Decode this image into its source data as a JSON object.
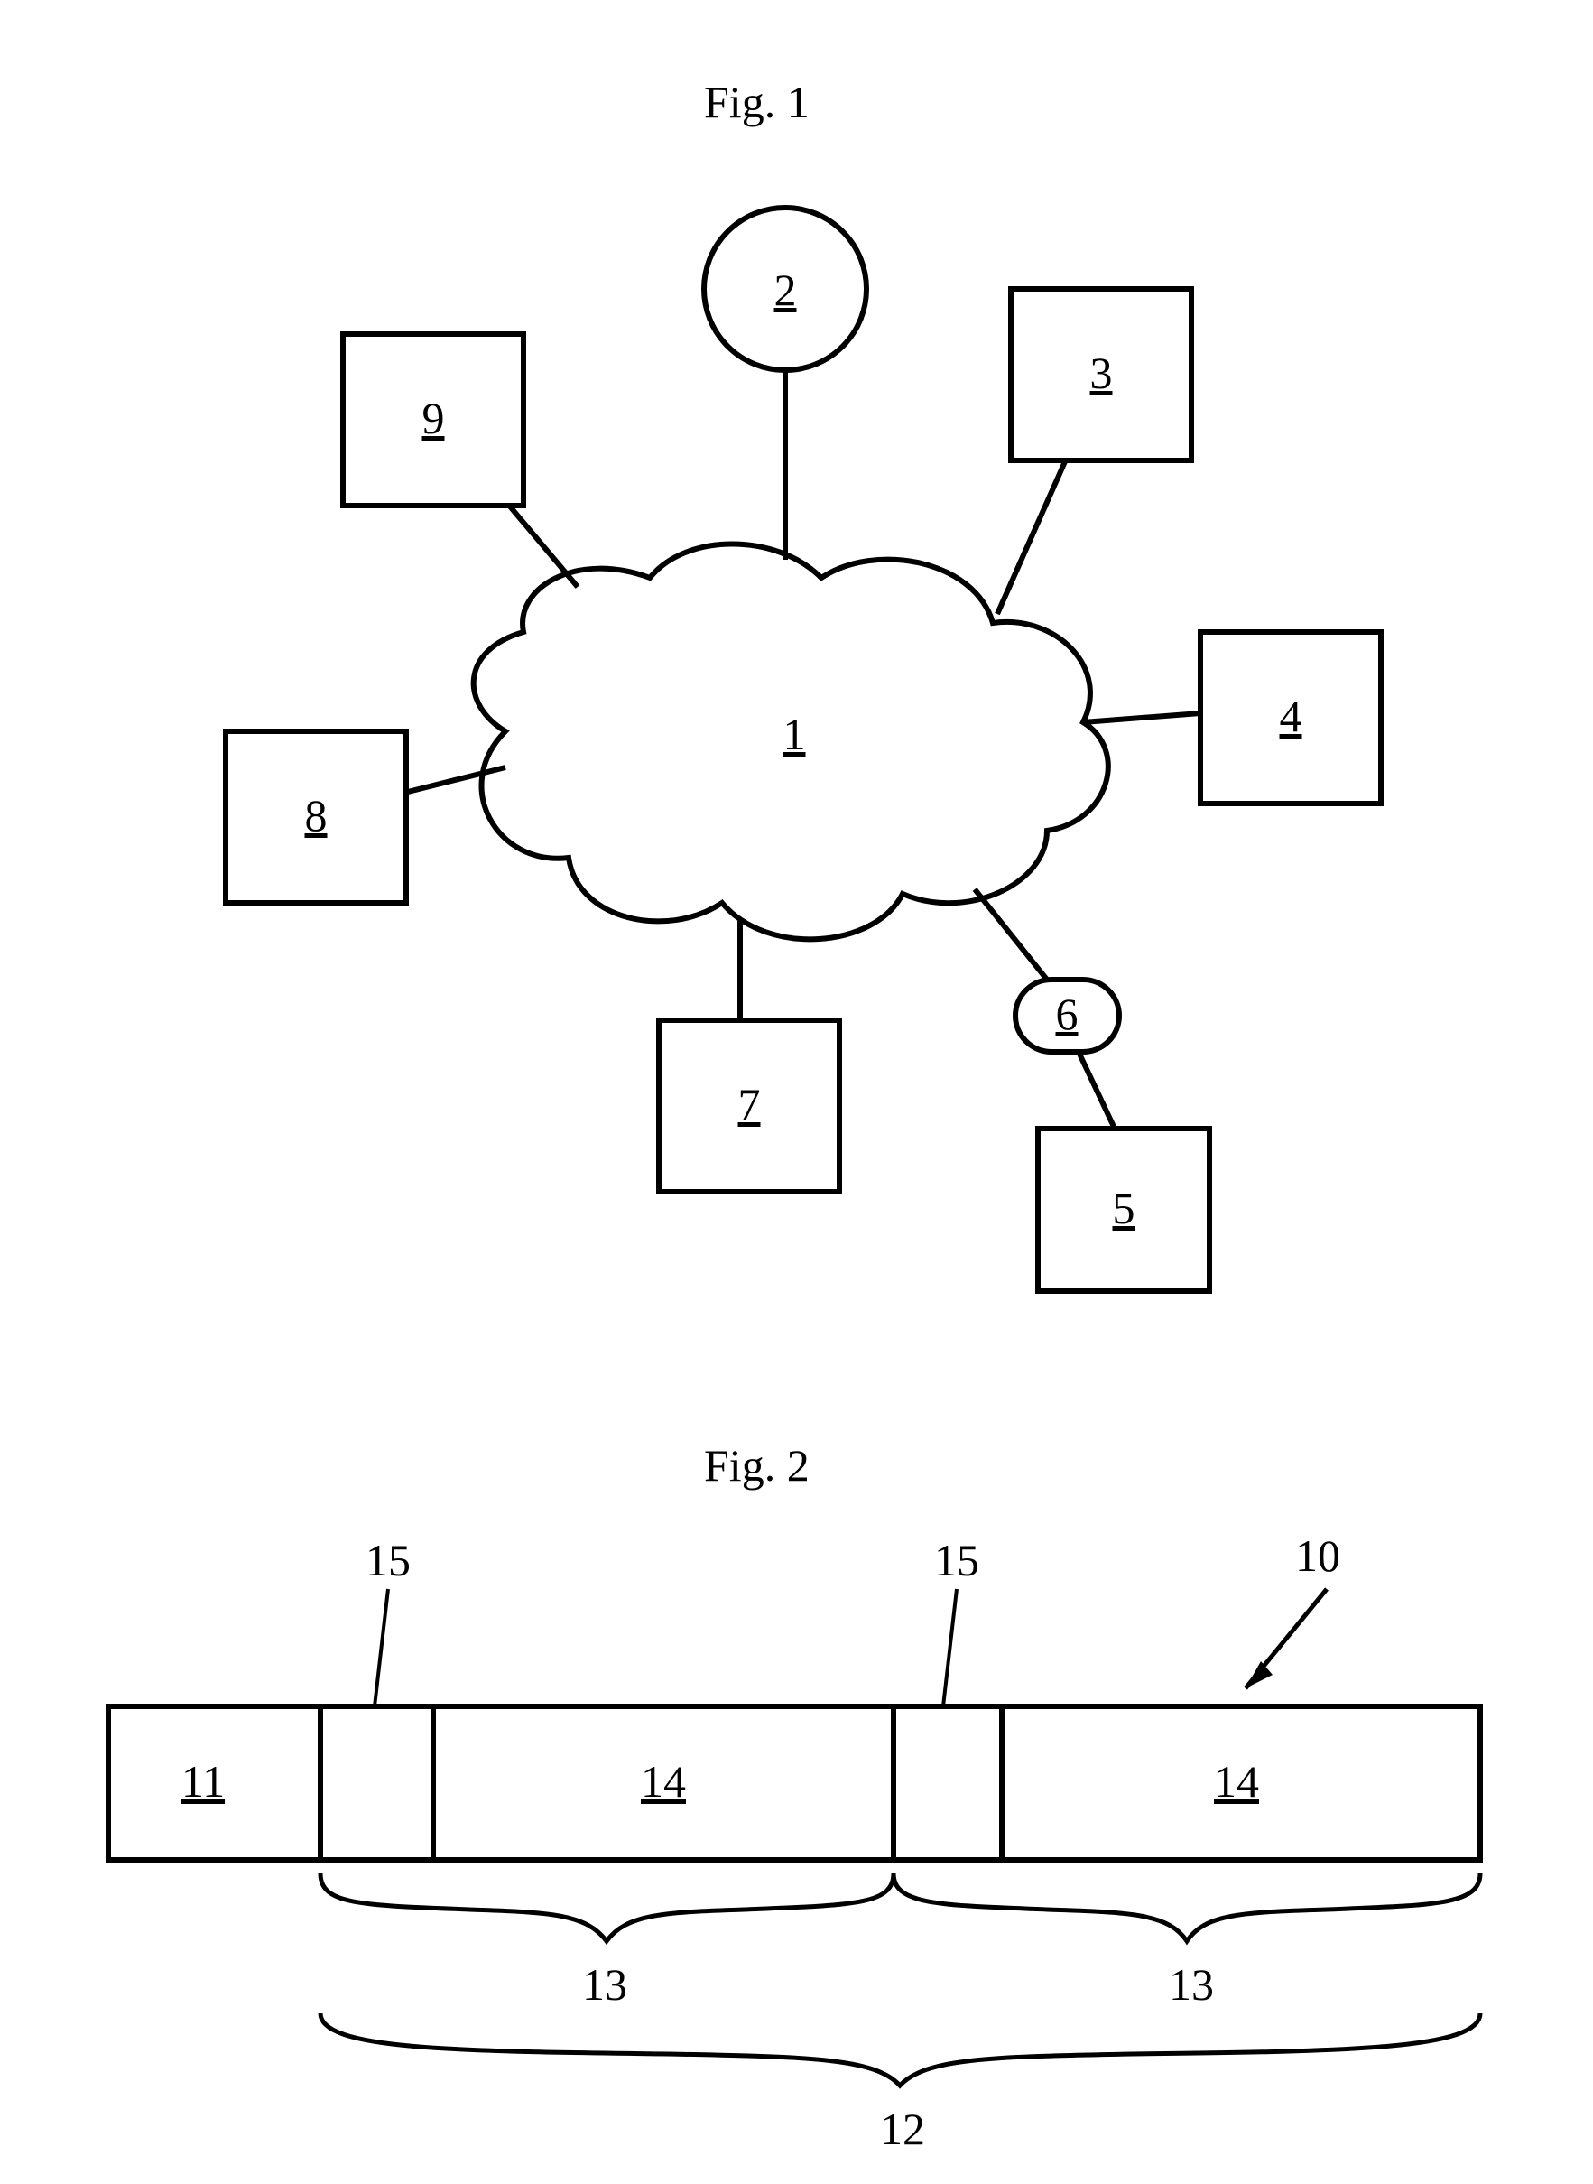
{
  "fig1": {
    "title": "Fig. 1",
    "cloud_label": "1",
    "nodes": {
      "n2": "2",
      "n3": "3",
      "n4": "4",
      "n5": "5",
      "n6": "6",
      "n7": "7",
      "n8": "8",
      "n9": "9"
    }
  },
  "fig2": {
    "title": "Fig. 2",
    "pointer": "10",
    "header_cell": "11",
    "payload_a": "14",
    "payload_b": "14",
    "top_label_a": "15",
    "top_label_b": "15",
    "brace_left": "13",
    "brace_right": "13",
    "brace_span": "12"
  }
}
